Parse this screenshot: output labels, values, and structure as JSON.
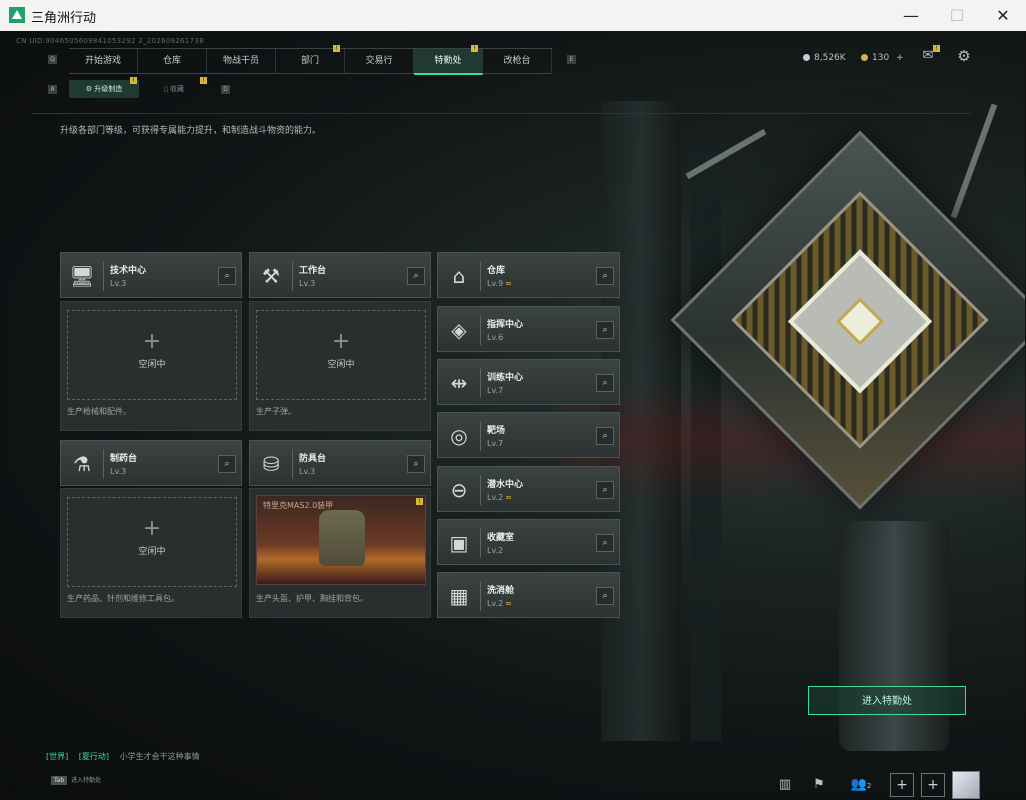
{
  "window": {
    "title": "三角洲行动",
    "minimize": "—",
    "maximize": "☐",
    "close": "✕"
  },
  "uid": "CN UID:9046505609841053292 2_20260926173B",
  "nav": {
    "left_key": "Q",
    "right_key": "E",
    "tabs": [
      {
        "label": "开始游戏"
      },
      {
        "label": "仓库"
      },
      {
        "label": "物战干员"
      },
      {
        "label": "部门",
        "badge": "!"
      },
      {
        "label": "交易行"
      },
      {
        "label": "特勤处",
        "badge": "!",
        "active": true
      },
      {
        "label": "改枪台"
      }
    ]
  },
  "resources": {
    "currency1": "8,526K",
    "currency2": "130",
    "plus": "+"
  },
  "subnav": {
    "left_key": "A",
    "right_key": "D",
    "tabs": [
      {
        "label": "升级制造",
        "badge": "!",
        "active": true
      },
      {
        "label": "收藏",
        "badge": "!"
      }
    ]
  },
  "description": "升级各部门等级，可获得专属能力提升，和制造战斗物资的能力。",
  "production": [
    {
      "name": "技术中心",
      "level": "Lv.3",
      "icon": "monitor-icon",
      "slot": {
        "plus": "+",
        "status": "空闲中"
      },
      "desc": "生产枪械和配件。"
    },
    {
      "name": "工作台",
      "level": "Lv.3",
      "icon": "tools-icon",
      "slot": {
        "plus": "+",
        "status": "空闲中"
      },
      "desc": "生产子弹。"
    },
    {
      "name": "制药台",
      "level": "Lv.3",
      "icon": "microscope-icon",
      "slot": {
        "plus": "+",
        "status": "空闲中"
      },
      "desc": "生产药品、针剂和维修工具包。"
    },
    {
      "name": "防具台",
      "level": "Lv.3",
      "icon": "armor-icon",
      "crafting": "特里克MAS2.0装甲",
      "badge": "!",
      "desc": "生产头盔、护甲、胸挂和背包。"
    }
  ],
  "facilities": [
    {
      "name": "仓库",
      "level": "Lv.9",
      "upgrade": "≈",
      "icon": "warehouse-icon"
    },
    {
      "name": "指挥中心",
      "level": "Lv.6",
      "icon": "command-icon"
    },
    {
      "name": "训练中心",
      "level": "Lv.7",
      "icon": "dumbbell-icon"
    },
    {
      "name": "靶场",
      "level": "Lv.7",
      "icon": "target-icon"
    },
    {
      "name": "潜水中心",
      "level": "Lv.2",
      "upgrade": "≈",
      "icon": "goggles-icon"
    },
    {
      "name": "收藏室",
      "level": "Lv.2",
      "icon": "vault-icon"
    },
    {
      "name": "洗消舱",
      "level": "Lv.2",
      "upgrade": "≈",
      "icon": "decon-icon"
    }
  ],
  "search_glyph": "⌕",
  "enter_button": "进入特勤处",
  "chat": {
    "channel": "[世界]",
    "user": "[夏行动]",
    "message": "小学生才会干这种事情"
  },
  "tab_hint": {
    "key": "Tab",
    "label": "进入特勤处"
  },
  "friends_count": "2",
  "colors": {
    "accent": "#3ddc97",
    "badge": "#d6b93c",
    "panel": "#2c3232"
  }
}
